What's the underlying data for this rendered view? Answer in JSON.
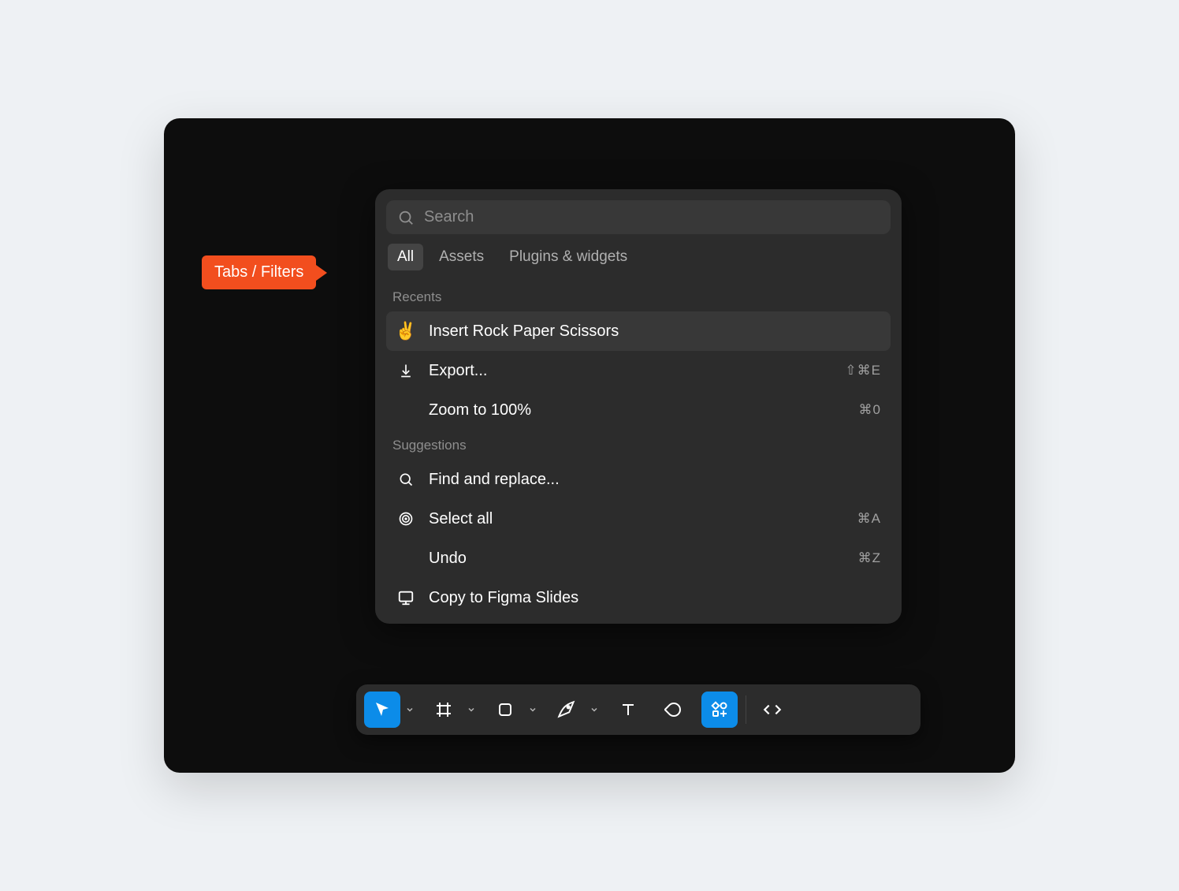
{
  "callout": {
    "label": "Tabs / Filters"
  },
  "search": {
    "placeholder": "Search"
  },
  "tabs": [
    {
      "label": "All",
      "active": true
    },
    {
      "label": "Assets",
      "active": false
    },
    {
      "label": "Plugins & widgets",
      "active": false
    }
  ],
  "sections": {
    "recents": {
      "title": "Recents",
      "items": [
        {
          "icon": "victory-emoji",
          "label": "Insert Rock Paper Scissors",
          "shortcut": "",
          "highlight": true
        },
        {
          "icon": "export-icon",
          "label": "Export...",
          "shortcut": "⇧⌘E"
        },
        {
          "icon": "",
          "label": "Zoom to 100%",
          "shortcut": "⌘0"
        }
      ]
    },
    "suggestions": {
      "title": "Suggestions",
      "items": [
        {
          "icon": "search-icon",
          "label": "Find and replace...",
          "shortcut": ""
        },
        {
          "icon": "target-icon",
          "label": "Select all",
          "shortcut": "⌘A"
        },
        {
          "icon": "",
          "label": "Undo",
          "shortcut": "⌘Z"
        },
        {
          "icon": "slides-icon",
          "label": "Copy to Figma Slides",
          "shortcut": ""
        }
      ]
    }
  },
  "toolbar": {
    "tools": [
      {
        "name": "move-tool",
        "active": true,
        "caret": true
      },
      {
        "name": "frame-tool",
        "active": false,
        "caret": true
      },
      {
        "name": "shape-tool",
        "active": false,
        "caret": true
      },
      {
        "name": "pen-tool",
        "active": false,
        "caret": true
      },
      {
        "name": "text-tool",
        "active": false,
        "caret": false
      },
      {
        "name": "comment-tool",
        "active": false,
        "caret": false
      },
      {
        "name": "actions-tool",
        "active": true,
        "caret": false
      }
    ],
    "devmode": {
      "name": "dev-mode-toggle"
    }
  }
}
